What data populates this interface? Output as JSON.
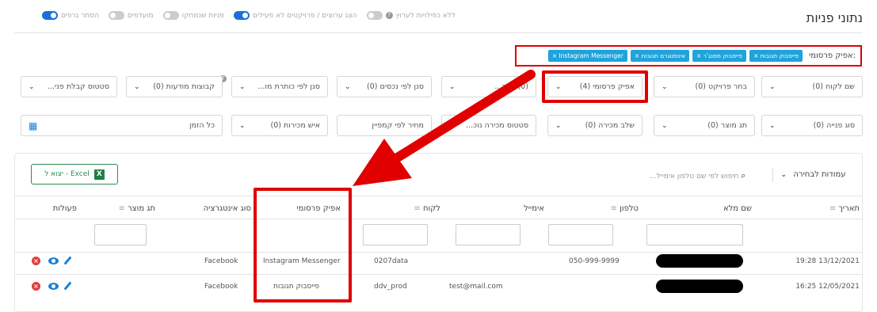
{
  "title": "נתוני פניות",
  "toggles": [
    {
      "label": "ללא כפילויות לערוץ",
      "on": false,
      "help": true
    },
    {
      "label": "הצג ערוצים / פרויקטים לא פעילים",
      "on": false
    },
    {
      "label": "פניות שנמחקו",
      "on": true
    },
    {
      "label": "מועדפים",
      "on": false
    },
    {
      "label": "הסתר גרפים",
      "on": false
    }
  ],
  "help_glyph": "?",
  "ad_filter": {
    "label": "אפיק פרסומי:",
    "chips": [
      "× פייסבוק תגובות",
      "× פייסבוק מסנג'ר",
      "× אינסטגרם תגובות",
      "× Instagram Messenger"
    ]
  },
  "filters_row1": [
    "שם לקוח (0)",
    "בחר פרויקט (0)",
    "אפיק פרסומי (4)",
    "(0) בחר...",
    "סנן לפי נכסים (0)",
    "סנן לפי כותרת מו...",
    "קבוצות מודעות (0)",
    "סטטוס קבלת פני..."
  ],
  "filters_row2": [
    "סוג פנייה (0)",
    "תג מוצר (0)",
    "שלב מכירה (0)",
    "סטטוס מכירה נוכ...",
    "מחיר לפי קמפיין",
    "איש מכירות (0)",
    "כל הזמן"
  ],
  "caret": "⌄",
  "excel": {
    "label": "יצוא ל - Excel",
    "icon": "X"
  },
  "search_placeholder": "חיפוש לפי שם טלפון אימייל...",
  "columns_label": "עמודות לבחירה",
  "columns_caret": "⌄",
  "search_icon": "⌕",
  "sort_icon": "≡",
  "cal_icon": "▦",
  "delete_glyph": "×",
  "headers": [
    "תאריך",
    "שם מלא",
    "טלפון",
    "אימייל",
    "לקוח",
    "אפיק פרסומי",
    "סוג אינטגרציה",
    "תג מוצר",
    "פעולות"
  ],
  "rows": [
    {
      "date": "19:28 13/12/2021",
      "name": "",
      "phone": "050-999-9999",
      "email": "",
      "client": "0207data",
      "channel": "Instagram Messenger",
      "integration": "Facebook"
    },
    {
      "date": "16:25 12/05/2021",
      "name": "",
      "phone": "",
      "email": "test@mail.com",
      "client": "ddv_prod",
      "channel": "פייסבוק תגובות",
      "integration": "Facebook"
    }
  ],
  "colors": {
    "accent": "#1fa3dc",
    "highlight": "#e00000",
    "toggle_on": "#1b6fd8",
    "excel": "#2e8b4e",
    "delete": "#e03d3d"
  }
}
